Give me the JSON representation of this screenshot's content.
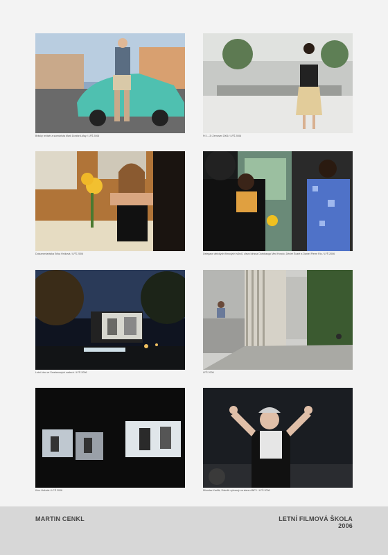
{
  "photos": [
    {
      "caption": "Britský režisér a scenárista Mark Donford-May / LFŠ 2006"
    },
    {
      "caption": "Fr3 – 2t Zemover 2006 / LFŠ 2006"
    },
    {
      "caption": "Dokumentaristka Erika Hníková / LFŠ 2006"
    },
    {
      "caption": "Delegace afrických filmových tvůrců, zleva Idrissa Ouédraogo Med Hondo, Désiré Écaré a Daniel Pierre Rio / LFŠ 2006"
    },
    {
      "caption": "Letní kino ve Smetanových sadech / LFŠ 2006"
    },
    {
      "caption": "LFŠ 2006"
    },
    {
      "caption": "Kino Hvězda / LFŠ 2006"
    },
    {
      "caption": "Miroslav Kadlík, Zdeněk výtvarný na stanu ANFV / LFŠ 2006"
    }
  ],
  "footer": {
    "author": "MARTIN CENKL",
    "event_line1": "LETNÍ FILMOVÁ ŠKOLA",
    "event_line2": "2006"
  }
}
